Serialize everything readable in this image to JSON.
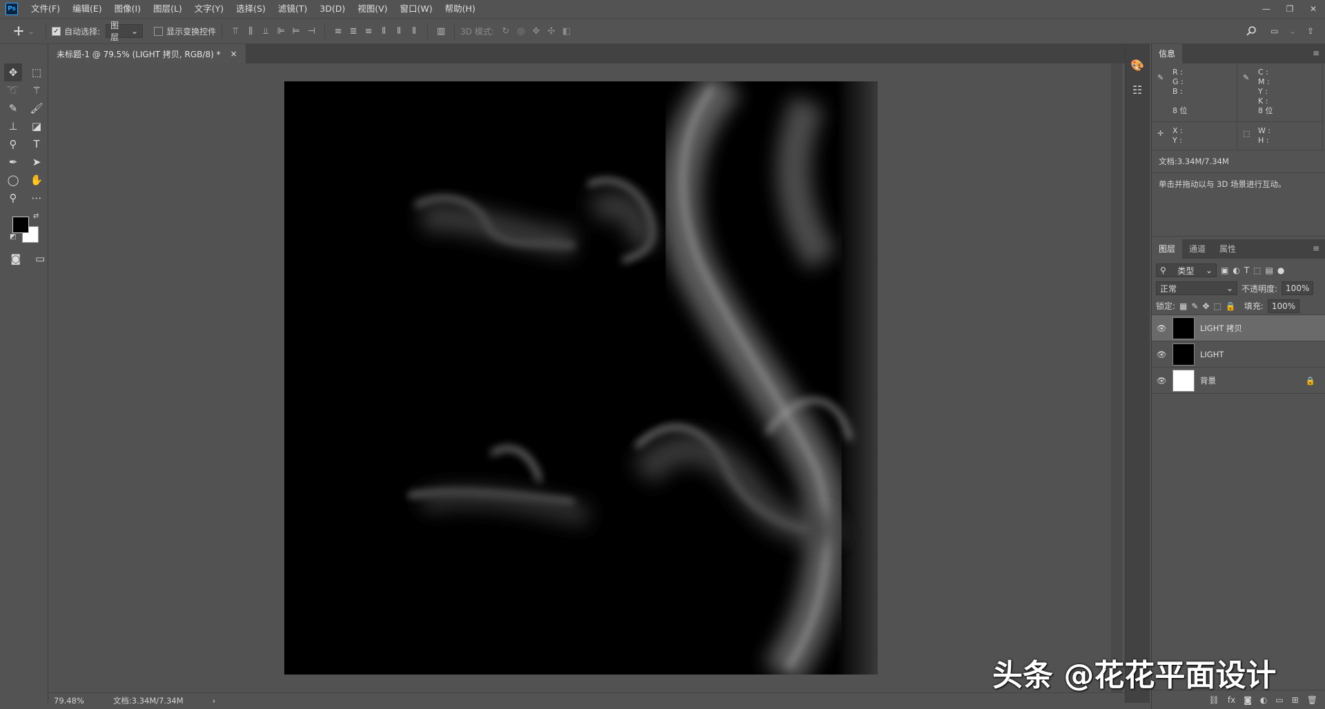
{
  "app": {
    "logo": "Ps"
  },
  "menu": [
    "文件(F)",
    "编辑(E)",
    "图像(I)",
    "图层(L)",
    "文字(Y)",
    "选择(S)",
    "滤镜(T)",
    "3D(D)",
    "视图(V)",
    "窗口(W)",
    "帮助(H)"
  ],
  "window_controls": {
    "minimize": "—",
    "restore": "❐",
    "close": "✕"
  },
  "options": {
    "auto_select_label": "自动选择:",
    "auto_select_checked": "✓",
    "auto_select_value": "图层",
    "show_transform_label": "显示变换控件",
    "mode_3d_label": "3D 模式:"
  },
  "document_tab": {
    "title": "未标题-1 @ 79.5% (LIGHT 拷贝, RGB/8) *",
    "close": "×"
  },
  "status": {
    "zoom": "79.48%",
    "doc_info": "文档:3.34M/7.34M",
    "arrow": "›"
  },
  "info_panel": {
    "tab": "信息",
    "rgb_labels": "R :\nG :\nB :",
    "cmyk_labels": "C :\nM :\nY :\nK :",
    "bits_left": "8 位",
    "bits_right": "8 位",
    "xy_labels": "X :\nY :",
    "wh_labels": "W :\nH :",
    "doc": "文档:3.34M/7.34M",
    "hint": "单击并拖动以与 3D 场景进行互动。"
  },
  "layers_panel": {
    "tabs": [
      "图层",
      "通道",
      "属性"
    ],
    "filter_kind": "类型",
    "blend_mode": "正常",
    "opacity_label": "不透明度:",
    "opacity_value": "100%",
    "lock_label": "锁定:",
    "fill_label": "填充:",
    "fill_value": "100%",
    "layers": [
      {
        "name": "LIGHT 拷贝",
        "selected": true
      },
      {
        "name": "LIGHT",
        "selected": false
      },
      {
        "name": "背景",
        "selected": false,
        "locked": true
      }
    ]
  },
  "watermark": "头条 @花花平面设计"
}
